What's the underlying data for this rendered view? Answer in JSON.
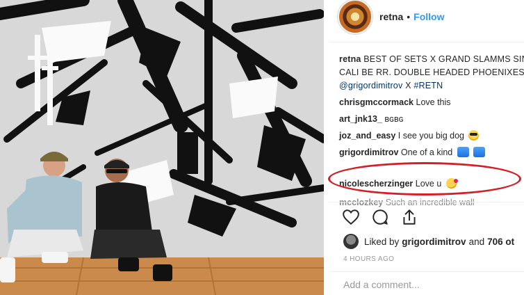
{
  "header": {
    "username": "retna",
    "separator": "•",
    "follow_label": "Follow"
  },
  "caption": {
    "username": "retna",
    "text": "BEST OF SETS X GRAND SLAMMS SINGN CALI BE RR. DOUBLE HEADED PHOENIXES X",
    "mention": "@grigordimitrov",
    "joiner": "X",
    "hashtag": "#RETN"
  },
  "comments": [
    {
      "username": "chrisgmccormack",
      "text": "Love this"
    },
    {
      "username": "art_jnk13_",
      "text": "ʙɢʙɢ"
    },
    {
      "username": "joz_and_easy",
      "text": "I see you big dog",
      "emoji": "sunglasses-emoji"
    },
    {
      "username": "grigordimitrov",
      "text": "One of a kind",
      "emoji": "bowing-emoji"
    },
    {
      "username": "nicolescherzinger",
      "text": "Love u",
      "emoji": "kiss-emoji"
    },
    {
      "username": "mcclozkey",
      "text": "Such an incredible wall"
    }
  ],
  "actions": {
    "icons": [
      "heart-icon",
      "comment-icon",
      "share-icon"
    ]
  },
  "likes": {
    "prefix": "Liked by",
    "user": "grigordimitrov",
    "conjunction": "and",
    "count": "706 ot"
  },
  "timestamp": "4 HOURS AGO",
  "add_comment": {
    "placeholder": "Add a comment..."
  },
  "colors": {
    "follow": "#3897f0",
    "highlight_circle": "#d22027",
    "mention": "#003569"
  }
}
